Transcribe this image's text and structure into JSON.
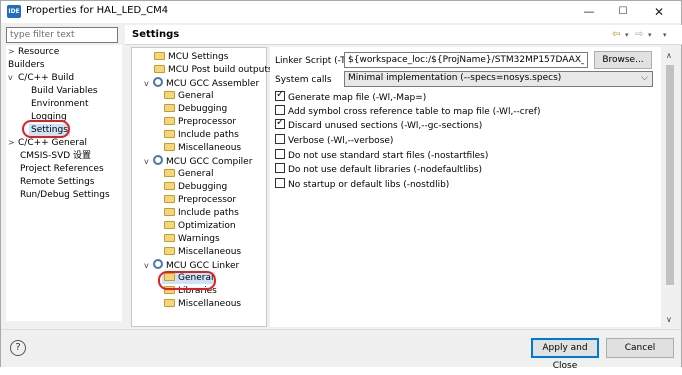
{
  "window": {
    "title": "Properties for HAL_LED_CM4",
    "app_icon": "IDE"
  },
  "filter": {
    "placeholder": "type filter text"
  },
  "nav": {
    "items": [
      {
        "label": "Resource",
        "arrow": ">"
      },
      {
        "label": "Builders",
        "arrow": ""
      },
      {
        "label": "C/C++ Build",
        "arrow": "v"
      },
      {
        "label": "Build Variables",
        "arrow": ""
      },
      {
        "label": "Environment",
        "arrow": ""
      },
      {
        "label": "Logging",
        "arrow": ""
      },
      {
        "label": "Settings",
        "arrow": ""
      },
      {
        "label": "C/C++ General",
        "arrow": ">"
      },
      {
        "label": "CMSIS-SVD 设置",
        "arrow": ""
      },
      {
        "label": "Project References",
        "arrow": ""
      },
      {
        "label": "Remote Settings",
        "arrow": ""
      },
      {
        "label": "Run/Debug Settings",
        "arrow": ""
      }
    ]
  },
  "header": {
    "title": "Settings"
  },
  "tool_tree": {
    "items": [
      {
        "label": "MCU Settings"
      },
      {
        "label": "MCU Post build outputs"
      },
      {
        "label": "MCU GCC Assembler",
        "arrow": "v"
      },
      {
        "label": "General"
      },
      {
        "label": "Debugging"
      },
      {
        "label": "Preprocessor"
      },
      {
        "label": "Include paths"
      },
      {
        "label": "Miscellaneous"
      },
      {
        "label": "MCU GCC Compiler",
        "arrow": "v"
      },
      {
        "label": "General"
      },
      {
        "label": "Debugging"
      },
      {
        "label": "Preprocessor"
      },
      {
        "label": "Include paths"
      },
      {
        "label": "Optimization"
      },
      {
        "label": "Warnings"
      },
      {
        "label": "Miscellaneous"
      },
      {
        "label": "MCU GCC Linker",
        "arrow": "v"
      },
      {
        "label": "General"
      },
      {
        "label": "Libraries"
      },
      {
        "label": "Miscellaneous"
      }
    ]
  },
  "linker": {
    "script_label": "Linker Script (-T)",
    "script_value": "${workspace_loc:/${ProjName}/STM32MP157DAAX_RAM.ld}",
    "browse_label": "Browse...",
    "syscalls_label": "System calls",
    "syscalls_value": "Minimal implementation (--specs=nosys.specs)"
  },
  "options": [
    {
      "label": "Generate map file (-Wl,-Map=)",
      "checked": true
    },
    {
      "label": "Add symbol cross reference table to map file (-Wl,--cref)",
      "checked": false
    },
    {
      "label": "Discard unused sections (-Wl,--gc-sections)",
      "checked": true
    },
    {
      "label": "Verbose (-Wl,--verbose)",
      "checked": false
    },
    {
      "label": "Do not use standard start files (-nostartfiles)",
      "checked": false
    },
    {
      "label": "Do not use default libraries (-nodefaultlibs)",
      "checked": false
    },
    {
      "label": "No startup or default libs (-nostdlib)",
      "checked": false
    }
  ],
  "buttons": {
    "apply_close": "Apply and Close",
    "cancel": "Cancel",
    "help": "?"
  }
}
